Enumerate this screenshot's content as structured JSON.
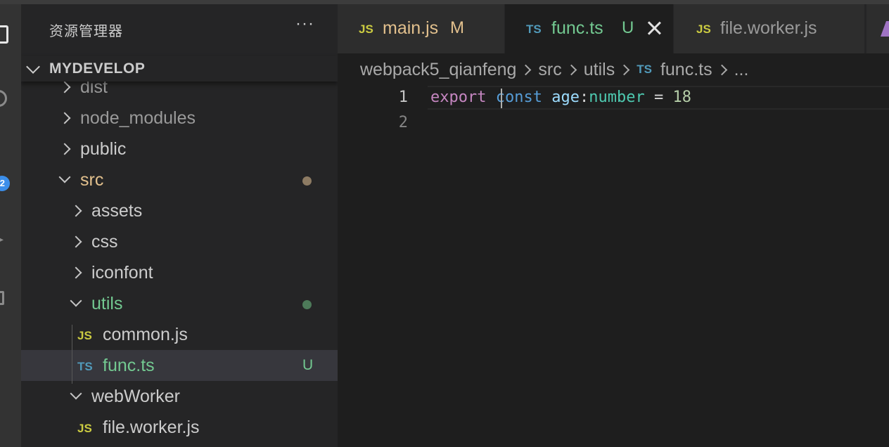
{
  "activity_bar": {
    "badge_count": "2",
    "icons": [
      "files-icon",
      "search-icon",
      "source-control-icon",
      "run-debug-icon",
      "extensions-icon"
    ]
  },
  "sidebar": {
    "title": "资源管理器",
    "more_actions": "···",
    "section_label": "MYDEVELOP",
    "tree": [
      {
        "label": "dist",
        "kind": "folder",
        "state": "collapsed"
      },
      {
        "label": "node_modules",
        "kind": "folder",
        "state": "collapsed"
      },
      {
        "label": "public",
        "kind": "folder",
        "state": "collapsed"
      },
      {
        "label": "src",
        "kind": "folder",
        "state": "expanded",
        "decoration": "modified-dot"
      },
      {
        "label": "assets",
        "kind": "folder",
        "state": "collapsed"
      },
      {
        "label": "css",
        "kind": "folder",
        "state": "collapsed"
      },
      {
        "label": "iconfont",
        "kind": "folder",
        "state": "collapsed"
      },
      {
        "label": "utils",
        "kind": "folder",
        "state": "expanded",
        "decoration": "untracked-dot"
      },
      {
        "label": "common.js",
        "kind": "file",
        "file_icon": "JS"
      },
      {
        "label": "func.ts",
        "kind": "file",
        "file_icon": "TS",
        "status": "U",
        "selected": true
      },
      {
        "label": "webWorker",
        "kind": "folder",
        "state": "expanded"
      },
      {
        "label": "file.worker.js",
        "kind": "file",
        "file_icon": "JS"
      }
    ]
  },
  "tabs": [
    {
      "icon": "JS",
      "label": "main.js",
      "status": "M",
      "active": false
    },
    {
      "icon": "TS",
      "label": "func.ts",
      "status": "U",
      "active": true
    },
    {
      "icon": "JS",
      "label": "file.worker.js",
      "status": "",
      "active": false
    }
  ],
  "breadcrumb": {
    "items": [
      "webpack5_qianfeng",
      "src",
      "utils",
      "func.ts",
      "..."
    ],
    "file_icon": "TS"
  },
  "editor": {
    "line_numbers": [
      "1",
      "2"
    ],
    "line1_tokens": {
      "export": "export",
      "const": "const",
      "identifier": "age",
      "colon": ":",
      "type": "number",
      "equals": " = ",
      "value": "18"
    }
  },
  "colors": {
    "editor_bg": "#1e1e1e",
    "sidebar_bg": "#252526",
    "selection_bg": "#37373d",
    "js_icon": "#cbcb41",
    "ts_icon": "#519aba",
    "untracked": "#73c991",
    "modified": "#e2c08d"
  }
}
